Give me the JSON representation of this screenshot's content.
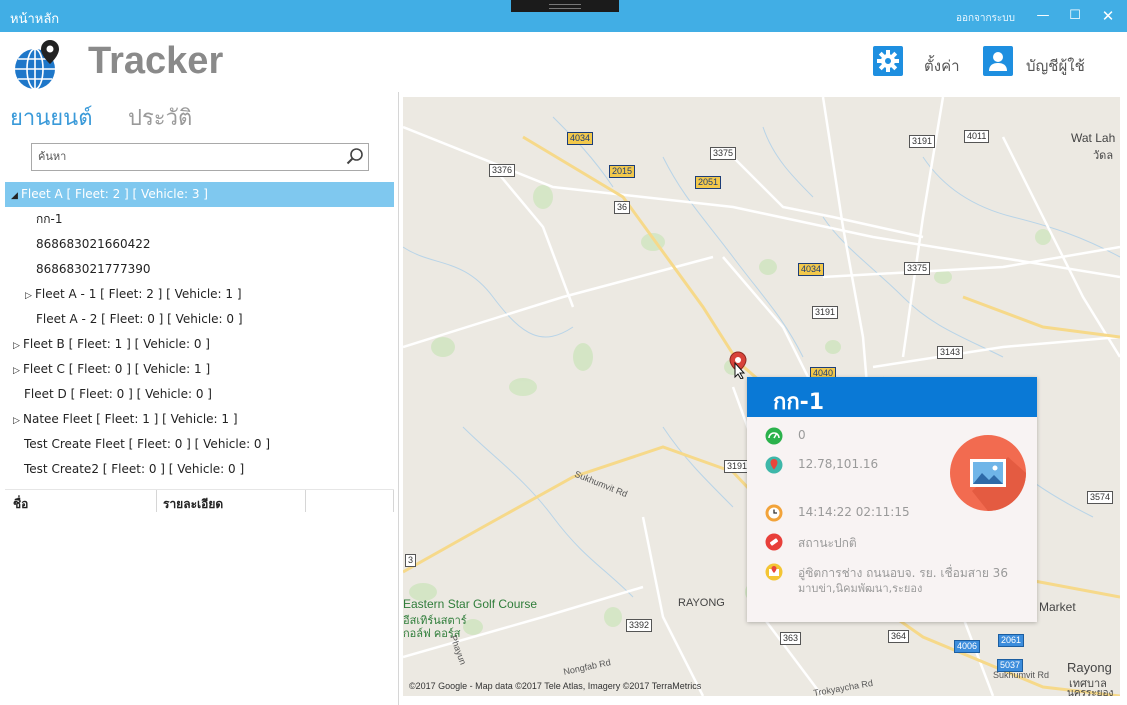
{
  "window": {
    "title": "หน้าหลัก",
    "logout": "ออกจากระบบ"
  },
  "header": {
    "brand": "Tracker",
    "settings_label": "ตั้งค่า",
    "account_label": "บัญชีผู้ใช้"
  },
  "sidebar": {
    "tabs": [
      {
        "label": "ยานยนต์"
      },
      {
        "label": "ประวัติ"
      }
    ],
    "search": {
      "placeholder": "ค้นหา",
      "value": ""
    },
    "tree": [
      {
        "label": "Fleet A [ Fleet: 2 ] [ Vehicle: 3 ]"
      },
      {
        "label": "กก-1"
      },
      {
        "label": "868683021660422"
      },
      {
        "label": "868683021777390"
      },
      {
        "label": "Fleet A - 1 [ Fleet: 2 ] [ Vehicle: 1 ]"
      },
      {
        "label": "Fleet A - 2 [ Fleet: 0 ] [ Vehicle: 0 ]"
      },
      {
        "label": "Fleet B [ Fleet: 1 ] [ Vehicle: 0 ]"
      },
      {
        "label": "Fleet C [ Fleet: 0 ] [ Vehicle: 1 ]"
      },
      {
        "label": "Fleet D [ Fleet: 0 ] [ Vehicle: 0 ]"
      },
      {
        "label": "Natee Fleet [ Fleet: 1 ] [ Vehicle: 1 ]"
      },
      {
        "label": "Test Create Fleet [ Fleet: 0 ] [ Vehicle: 0 ]"
      },
      {
        "label": "Test Create2 [ Fleet: 0 ] [ Vehicle: 0 ]"
      }
    ],
    "grid": {
      "col_name": "ชื่อ",
      "col_detail": "รายละเอียด"
    }
  },
  "map": {
    "copyright": "©2017 Google - Map data ©2017 Tele Atlas, Imagery ©2017 TerraMetrics",
    "shields": [
      "4034",
      "3375",
      "4011",
      "3191",
      "3376",
      "2015",
      "2051",
      "36",
      "4034",
      "3375",
      "3191",
      "3143",
      "4040",
      "3191",
      "3574",
      "3392",
      "363",
      "364",
      "4006",
      "2061",
      "5037",
      "3"
    ],
    "places": [
      "Wat Lah",
      "วัดล",
      "Eastern Star Golf Course",
      "อีสเทิร์นสตาร์",
      "กอล์ฟ คอร์ส",
      "RAYONG",
      "Market",
      "Rayong",
      "เทศบาล",
      "นครระยอง"
    ],
    "roads": [
      "Sukhumvit Rd",
      "Sukhumvit Rd",
      "Nongfab Rd",
      "Trokyaycha Rd",
      "Phayun"
    ]
  },
  "popup": {
    "title": "กก-1",
    "speed": "0",
    "coords": "12.78,101.16",
    "time": "14:14:22 02:11:15",
    "status": "สถานะปกติ",
    "address_line1": "อู่ซิตการช่าง ถนนอบจ. รย. เชื่อมสาย 36",
    "address_line2": "มาบข่า,นิคมพัฒนา,ระยอง"
  },
  "colors": {
    "titlebar": "#41aee5",
    "accent": "#1e8fe0",
    "selected_row": "#7fc8ef",
    "popup_header": "#0a79d6",
    "photo_badge": "#f26b50"
  }
}
